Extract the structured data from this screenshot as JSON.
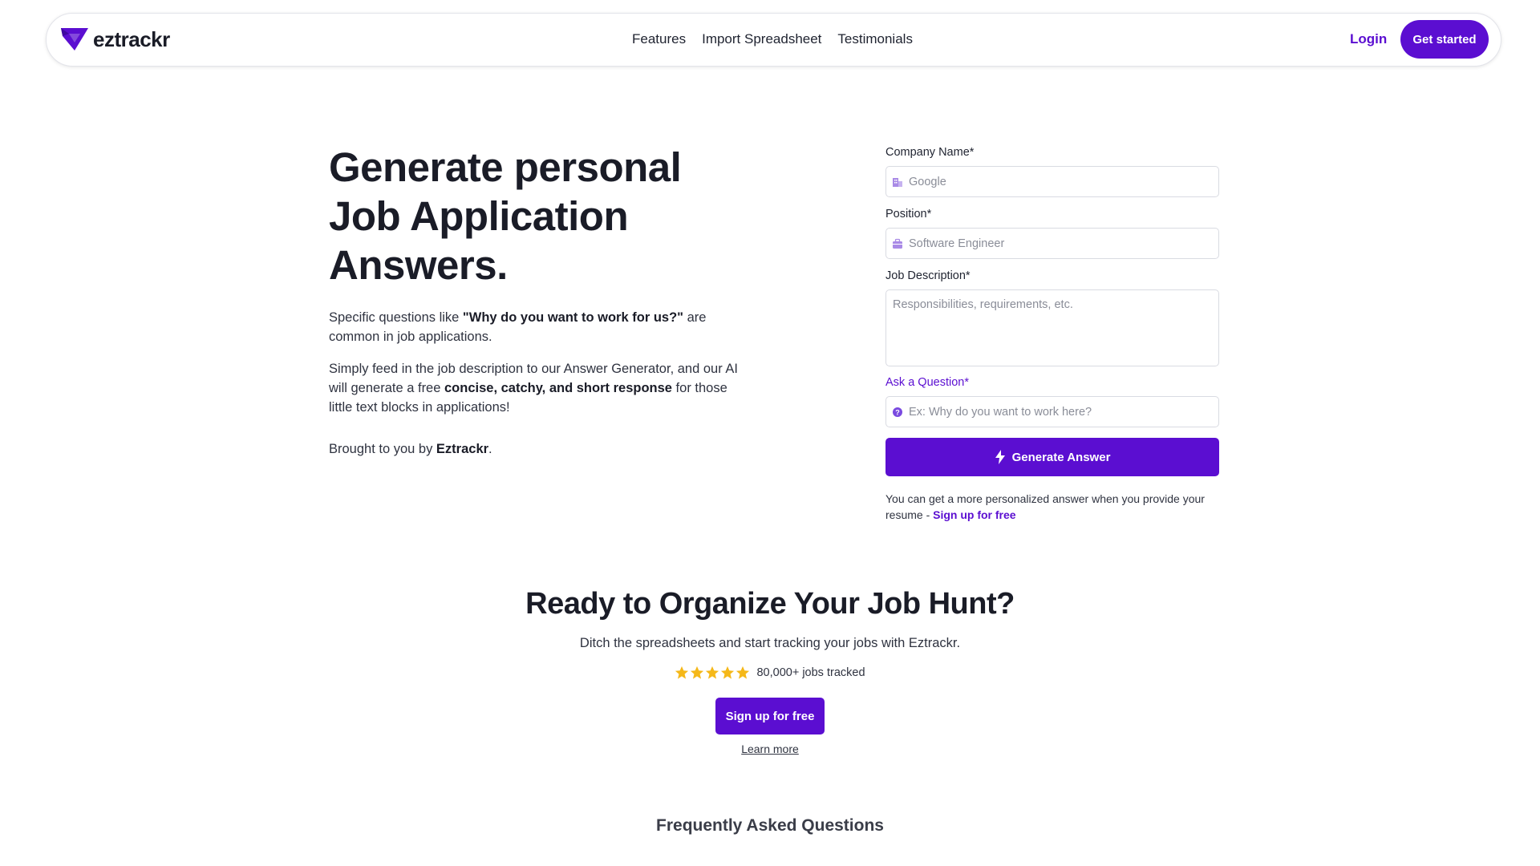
{
  "nav": {
    "logo_text": "eztrackr",
    "links": [
      "Features",
      "Import Spreadsheet",
      "Testimonials"
    ],
    "login": "Login",
    "get_started": "Get started"
  },
  "hero": {
    "title": "Generate personal Job Application Answers.",
    "p1_before": "Specific questions like ",
    "p1_bold": "\"Why do you want to work for us?\"",
    "p1_after": " are common in job applications.",
    "p2_before": "Simply feed in the job description to our Answer Generator, and our AI will generate a free ",
    "p2_bold": "concise, catchy, and short response",
    "p2_after": " for those little text blocks in applications!",
    "p3_before": "Brought to you by ",
    "p3_bold": "Eztrackr",
    "p3_after": "."
  },
  "form": {
    "company_label": "Company Name*",
    "company_placeholder": "Google",
    "position_label": "Position*",
    "position_placeholder": "Software Engineer",
    "description_label": "Job Description*",
    "description_placeholder": "Responsibilities, requirements, etc.",
    "question_label": "Ask a Question*",
    "question_placeholder": "Ex: Why do you want to work here?",
    "generate_button": "Generate Answer",
    "note_before": "You can get a more personalized answer when you provide your resume - ",
    "note_link": "Sign up for free"
  },
  "cta": {
    "title": "Ready to Organize Your Job Hunt?",
    "subtitle": "Ditch the spreadsheets and start tracking your jobs with Eztrackr.",
    "stars": 5,
    "rating_text": "80,000+ jobs tracked",
    "signup_button": "Sign up for free",
    "learn_more": "Learn more"
  },
  "faq": {
    "title": "Frequently Asked Questions"
  },
  "colors": {
    "accent": "#5b0ed1",
    "star": "#f5b819"
  }
}
